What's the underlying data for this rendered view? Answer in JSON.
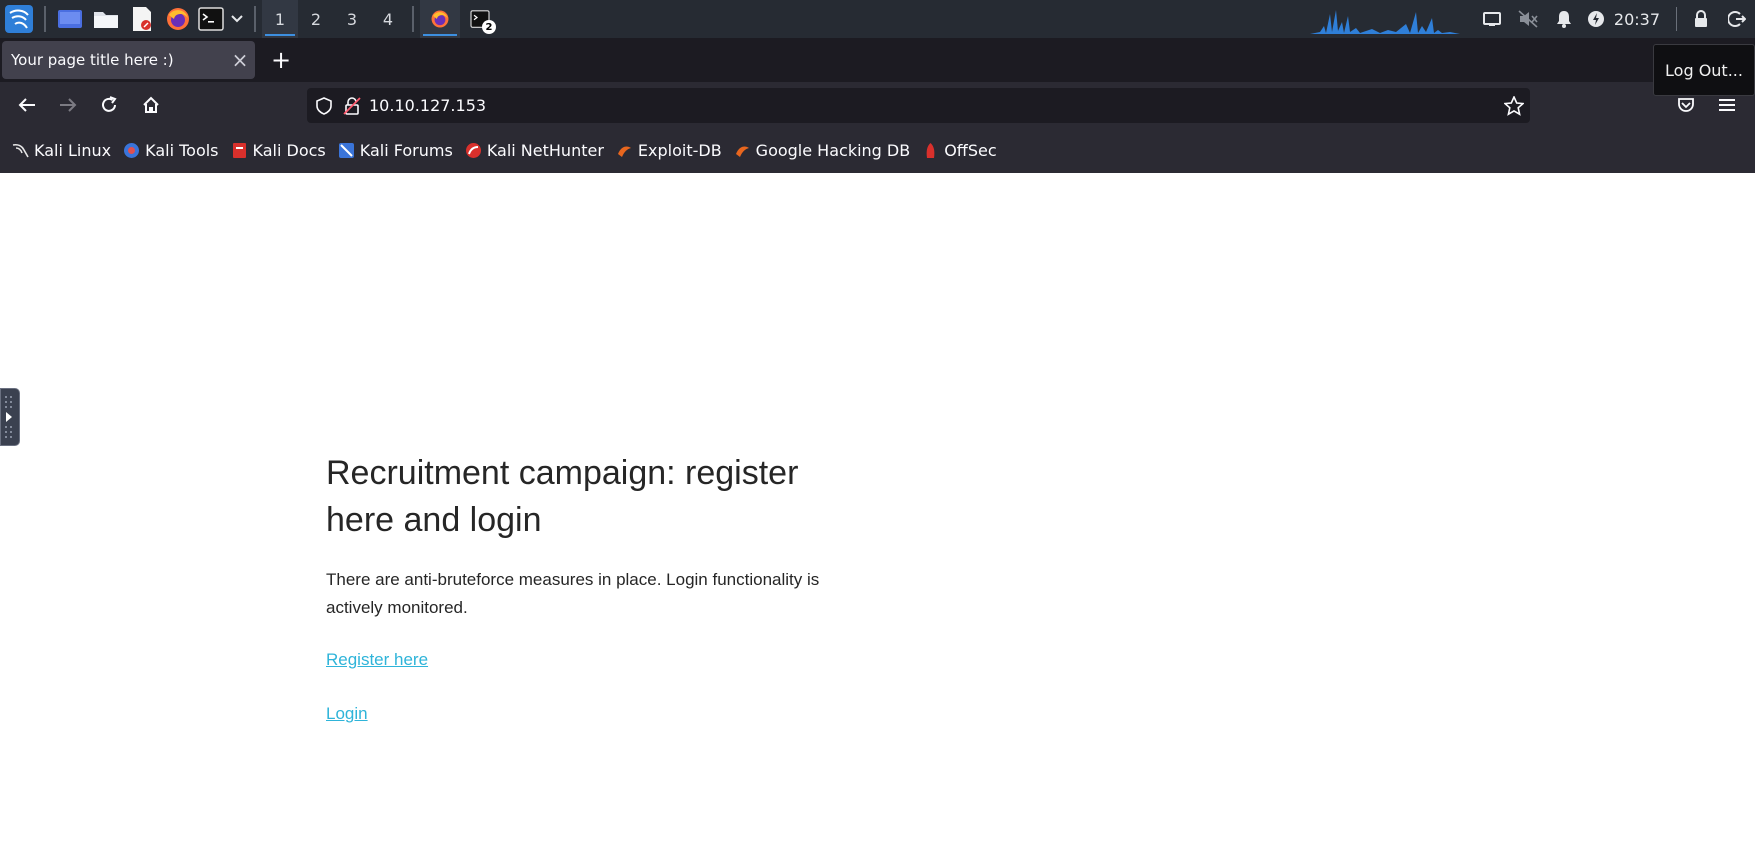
{
  "panel": {
    "workspaces": [
      "1",
      "2",
      "3",
      "4"
    ],
    "active_workspace": "1",
    "terminal_badge": "2",
    "clock": "20:37",
    "accent": "#3d8fe0"
  },
  "browser": {
    "tab_title": "Your page title here :)",
    "tab_close": "×",
    "new_tab": "+",
    "url": "10.10.127.153",
    "tooltip": "Log Out..."
  },
  "bookmarks": [
    {
      "label": "Kali Linux",
      "icon": "kali-dragon-icon"
    },
    {
      "label": "Kali Tools",
      "icon": "kali-tools-icon"
    },
    {
      "label": "Kali Docs",
      "icon": "kali-docs-icon"
    },
    {
      "label": "Kali Forums",
      "icon": "kali-forums-icon"
    },
    {
      "label": "Kali NetHunter",
      "icon": "nethunter-icon"
    },
    {
      "label": "Exploit-DB",
      "icon": "exploit-db-icon"
    },
    {
      "label": "Google Hacking DB",
      "icon": "ghdb-icon"
    },
    {
      "label": "OffSec",
      "icon": "offsec-icon"
    }
  ],
  "page": {
    "heading": "Recruitment campaign: register here and login",
    "description": "There are anti-bruteforce measures in place. Login functionality is actively monitored.",
    "register_link": "Register here",
    "login_link": "Login",
    "link_color": "#2fb4d9"
  }
}
